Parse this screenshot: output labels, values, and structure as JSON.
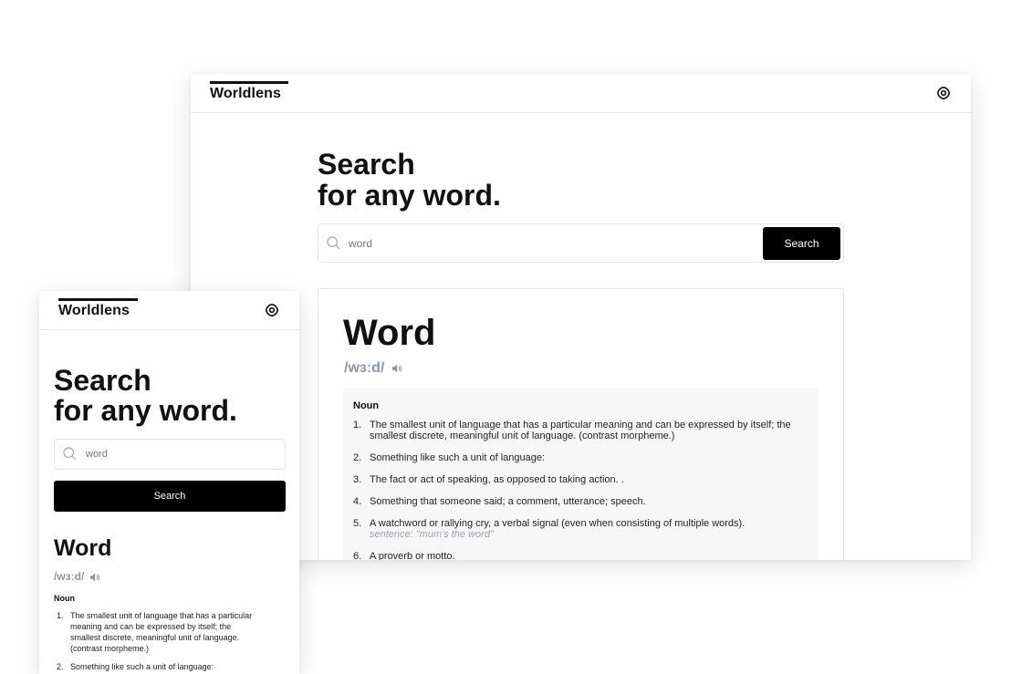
{
  "app": {
    "name": "Worldlens"
  },
  "search": {
    "title_line1": "Search",
    "title_line2": "for any word.",
    "placeholder": "word",
    "button_label": "Search"
  },
  "result": {
    "word": "Word",
    "phonetic": "/wɜːd/",
    "part_of_speech": "Noun",
    "definitions": [
      {
        "num": "1.",
        "text": "The smallest unit of language that has a particular meaning and can be expressed by itself; the smallest discrete, meaningful unit of language. (contrast morpheme.)",
        "example": ""
      },
      {
        "num": "2.",
        "text": "Something like such a unit of language:",
        "example": ""
      },
      {
        "num": "3.",
        "text": "The fact or act of speaking, as opposed to taking action. .",
        "example": ""
      },
      {
        "num": "4.",
        "text": "Something that someone said; a comment, utterance; speech.",
        "example": ""
      },
      {
        "num": "5.",
        "text": "A watchword or rallying cry, a verbal signal (even when consisting of multiple words).",
        "example": "sentence: \"mum's the word\""
      },
      {
        "num": "6.",
        "text": "A proverb or motto.",
        "example": ""
      }
    ]
  },
  "icons": {
    "settings": "gear-icon",
    "search": "search-icon",
    "audio": "speaker-icon"
  },
  "colors": {
    "accent": "#000000",
    "phonetic": "#8a95a6",
    "panel_bg": "#f7f7f8",
    "example": "#9aa3b2",
    "border": "#e6e6e6"
  }
}
